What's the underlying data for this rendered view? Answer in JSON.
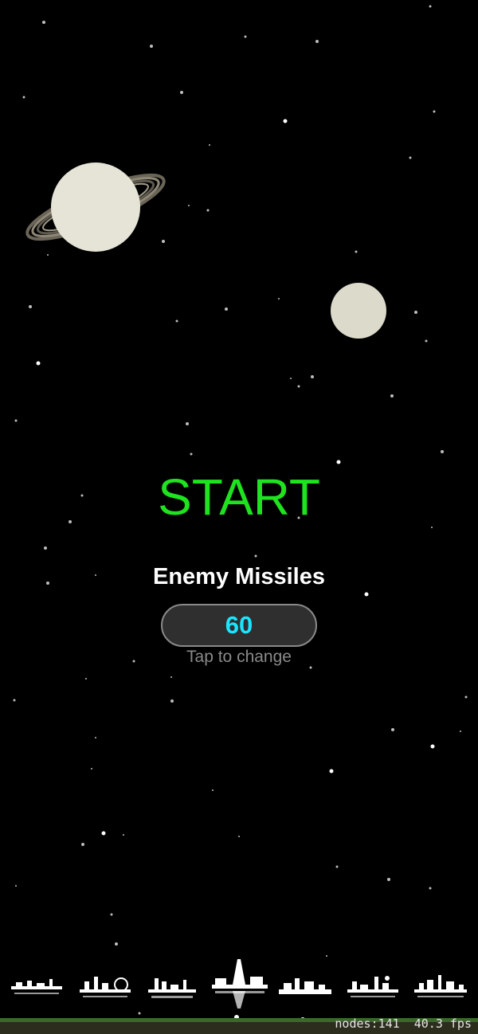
{
  "menu": {
    "start_label": "START",
    "missiles_label": "Enemy Missiles",
    "missiles_value": "60",
    "hint": "Tap to change"
  },
  "debug": {
    "nodes": "nodes:141",
    "fps": "40.3 fps"
  },
  "scene": {
    "planets": [
      "ringed-planet",
      "moon"
    ],
    "cities": [
      "city-1",
      "city-2",
      "city-3",
      "city-paris",
      "city-5",
      "city-6",
      "city-7"
    ]
  },
  "colors": {
    "background": "#000000",
    "start": "#1ee31e",
    "value": "#19e6ff",
    "planet": "#e6e4d6",
    "ground": "#3a6a2a"
  }
}
